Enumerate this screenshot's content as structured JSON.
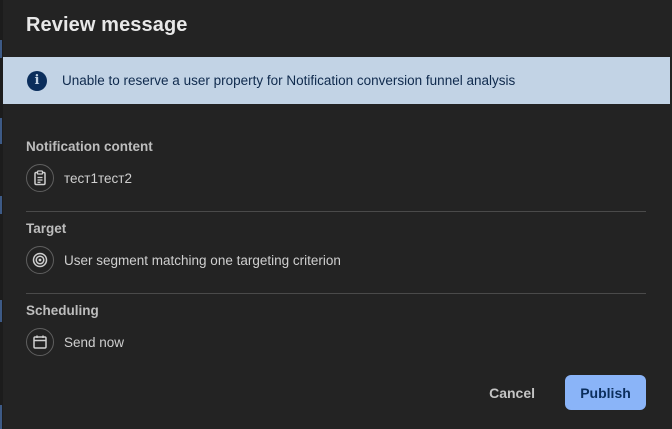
{
  "dialog": {
    "title": "Review message"
  },
  "banner": {
    "icon": "info-icon",
    "glyph": "i",
    "text": "Unable to reserve a user property for Notification conversion funnel analysis"
  },
  "sections": {
    "content": {
      "heading": "Notification content",
      "icon": "clipboard-icon",
      "value": "тест1тест2"
    },
    "target": {
      "heading": "Target",
      "icon": "target-icon",
      "value": "User segment matching one targeting criterion"
    },
    "scheduling": {
      "heading": "Scheduling",
      "icon": "calendar-icon",
      "value": "Send now"
    }
  },
  "actions": {
    "cancel_label": "Cancel",
    "publish_label": "Publish"
  },
  "colors": {
    "banner_bg": "#c2d3e5",
    "accent": "#8ab4f8",
    "dialog_bg": "#232323"
  }
}
